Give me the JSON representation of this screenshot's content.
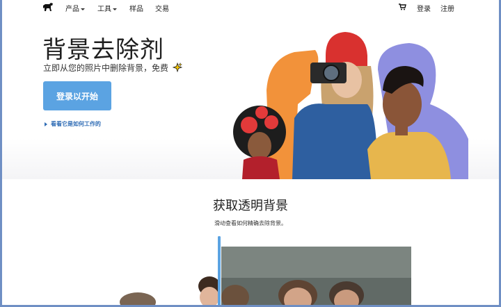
{
  "nav": {
    "items": [
      {
        "label": "产品",
        "has_caret": true
      },
      {
        "label": "工具",
        "has_caret": true
      },
      {
        "label": "样品",
        "has_caret": false
      },
      {
        "label": "交易",
        "has_caret": false
      }
    ],
    "login": "登录",
    "signup": "注册",
    "cart_icon": "cart-icon",
    "logo_icon": "horse-logo-icon"
  },
  "hero": {
    "title": "背景去除剂",
    "subtitle": "立即从您的照片中删除背景，免费",
    "cta": "登录以开始",
    "how_link": "看看它是如何工作的"
  },
  "section": {
    "title": "获取透明背景",
    "subtitle": "滑动查看如何精确去除背景。"
  },
  "colors": {
    "accent": "#5ba3e2",
    "link": "#2f6cb5",
    "border": "#6f8fc4"
  }
}
